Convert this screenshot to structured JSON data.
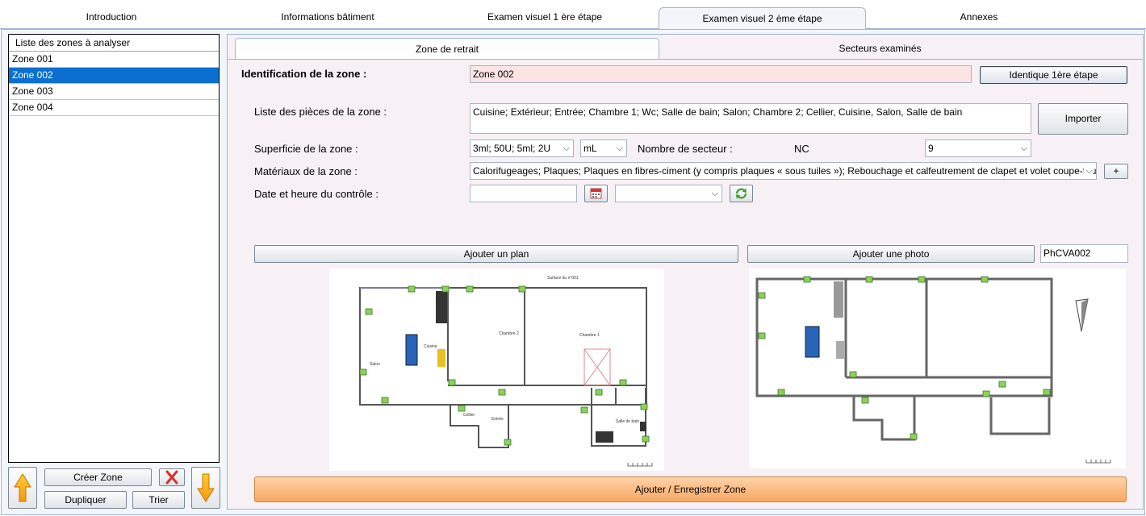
{
  "main_tabs": [
    {
      "label": "Introduction"
    },
    {
      "label": "Informations bâtiment"
    },
    {
      "label": "Examen visuel 1 ère étape"
    },
    {
      "label": "Examen visuel 2 ème étape"
    },
    {
      "label": "Annexes"
    }
  ],
  "zones": {
    "header": "Liste des zones à analyser",
    "items": [
      "Zone 001",
      "Zone 002",
      "Zone 003",
      "Zone 004"
    ],
    "selected": "Zone 002"
  },
  "zone_buttons": {
    "create": "Créer Zone",
    "duplicate": "Dupliquer",
    "sort": "Trier"
  },
  "sub_tabs": [
    {
      "label": "Zone de retrait"
    },
    {
      "label": "Secteurs examinés"
    }
  ],
  "form": {
    "id_label": "Identification de la zone :",
    "id_value": "Zone 002",
    "same_button": "Identique 1ère étape",
    "rooms_label": "Liste des pièces de la zone :",
    "rooms_value": "Cuisine; Extérieur; Entrée; Chambre 1; Wc; Salle de bain; Salon; Chambre 2; Cellier, Cuisine, Salon, Salle de bain",
    "import_button": "Importer",
    "area_label": "Superficie de la zone :",
    "area_value": "3ml; 50U; 5ml; 2U",
    "area_unit": "mL",
    "sectors_label": "Nombre de secteur :",
    "sectors_nc": "NC",
    "sectors_value": "9",
    "materials_label": "Matériaux de la zone :",
    "materials_value": "Calorifugeages; Plaques; Plaques en fibres-ciment (y compris plaques « sous tuiles »); Rebouchage et calfeutrement de clapet et volet coupe-feu",
    "add_button": "+",
    "date_label": "Date et heure du contrôle :",
    "date_value": "",
    "time_value": ""
  },
  "media": {
    "add_plan": "Ajouter un plan",
    "add_photo": "Ajouter une photo",
    "photo_ref": "PhCVA002",
    "plan_title": "Surface du n°001",
    "room_labels": [
      "Chambre 2",
      "Chambre 1",
      "Cuisine",
      "Salon",
      "Entrée",
      "Cellier",
      "Salle de bain"
    ]
  },
  "save_button": "Ajouter / Enregistrer Zone",
  "colors": {
    "selected": "#0a6fd1",
    "accent_orange": "#f7a764",
    "pink_field": "#fde4e4",
    "marker_green": "#6ab04c",
    "sofa_blue": "#2a64b8"
  }
}
